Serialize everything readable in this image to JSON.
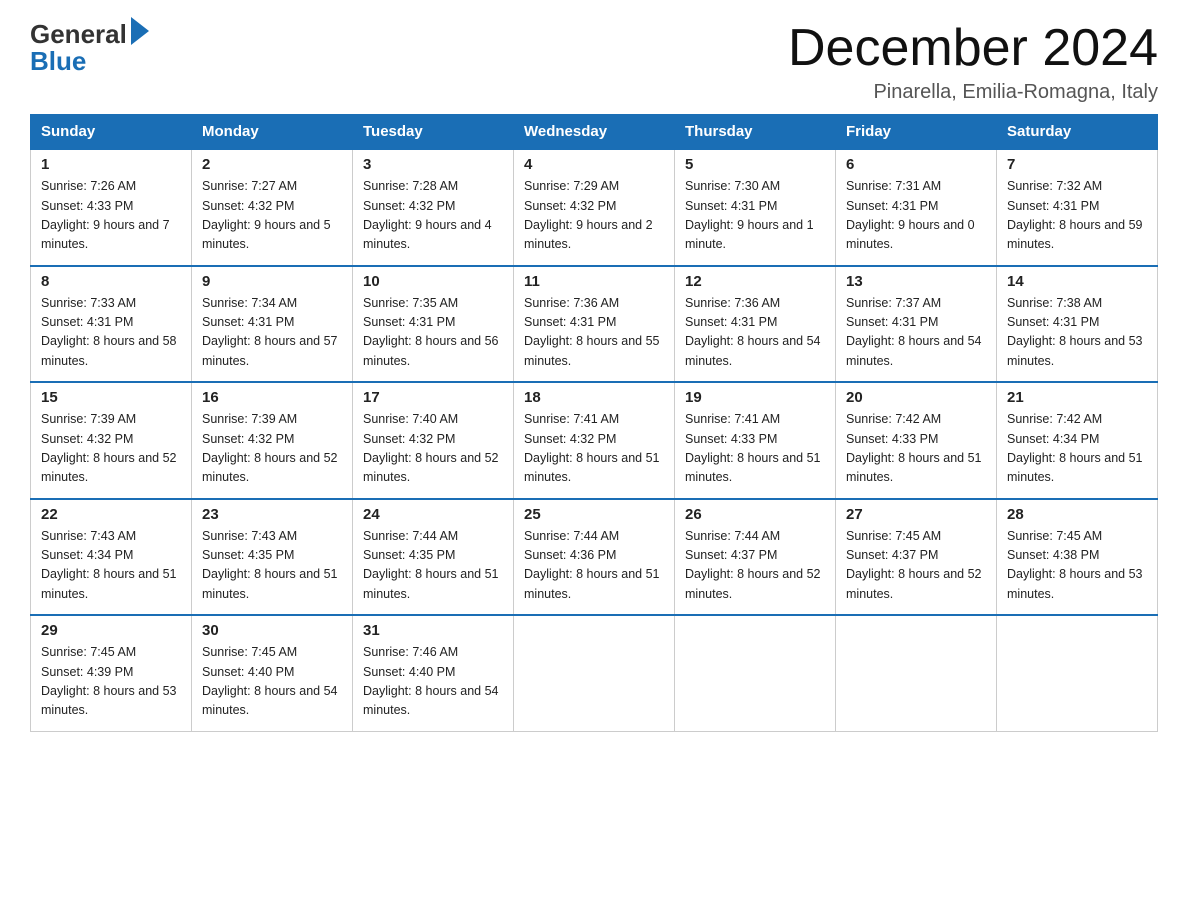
{
  "logo": {
    "general": "General",
    "blue": "Blue"
  },
  "title": "December 2024",
  "subtitle": "Pinarella, Emilia-Romagna, Italy",
  "days_of_week": [
    "Sunday",
    "Monday",
    "Tuesday",
    "Wednesday",
    "Thursday",
    "Friday",
    "Saturday"
  ],
  "weeks": [
    [
      {
        "day": "1",
        "sunrise": "7:26 AM",
        "sunset": "4:33 PM",
        "daylight": "9 hours and 7 minutes."
      },
      {
        "day": "2",
        "sunrise": "7:27 AM",
        "sunset": "4:32 PM",
        "daylight": "9 hours and 5 minutes."
      },
      {
        "day": "3",
        "sunrise": "7:28 AM",
        "sunset": "4:32 PM",
        "daylight": "9 hours and 4 minutes."
      },
      {
        "day": "4",
        "sunrise": "7:29 AM",
        "sunset": "4:32 PM",
        "daylight": "9 hours and 2 minutes."
      },
      {
        "day": "5",
        "sunrise": "7:30 AM",
        "sunset": "4:31 PM",
        "daylight": "9 hours and 1 minute."
      },
      {
        "day": "6",
        "sunrise": "7:31 AM",
        "sunset": "4:31 PM",
        "daylight": "9 hours and 0 minutes."
      },
      {
        "day": "7",
        "sunrise": "7:32 AM",
        "sunset": "4:31 PM",
        "daylight": "8 hours and 59 minutes."
      }
    ],
    [
      {
        "day": "8",
        "sunrise": "7:33 AM",
        "sunset": "4:31 PM",
        "daylight": "8 hours and 58 minutes."
      },
      {
        "day": "9",
        "sunrise": "7:34 AM",
        "sunset": "4:31 PM",
        "daylight": "8 hours and 57 minutes."
      },
      {
        "day": "10",
        "sunrise": "7:35 AM",
        "sunset": "4:31 PM",
        "daylight": "8 hours and 56 minutes."
      },
      {
        "day": "11",
        "sunrise": "7:36 AM",
        "sunset": "4:31 PM",
        "daylight": "8 hours and 55 minutes."
      },
      {
        "day": "12",
        "sunrise": "7:36 AM",
        "sunset": "4:31 PM",
        "daylight": "8 hours and 54 minutes."
      },
      {
        "day": "13",
        "sunrise": "7:37 AM",
        "sunset": "4:31 PM",
        "daylight": "8 hours and 54 minutes."
      },
      {
        "day": "14",
        "sunrise": "7:38 AM",
        "sunset": "4:31 PM",
        "daylight": "8 hours and 53 minutes."
      }
    ],
    [
      {
        "day": "15",
        "sunrise": "7:39 AM",
        "sunset": "4:32 PM",
        "daylight": "8 hours and 52 minutes."
      },
      {
        "day": "16",
        "sunrise": "7:39 AM",
        "sunset": "4:32 PM",
        "daylight": "8 hours and 52 minutes."
      },
      {
        "day": "17",
        "sunrise": "7:40 AM",
        "sunset": "4:32 PM",
        "daylight": "8 hours and 52 minutes."
      },
      {
        "day": "18",
        "sunrise": "7:41 AM",
        "sunset": "4:32 PM",
        "daylight": "8 hours and 51 minutes."
      },
      {
        "day": "19",
        "sunrise": "7:41 AM",
        "sunset": "4:33 PM",
        "daylight": "8 hours and 51 minutes."
      },
      {
        "day": "20",
        "sunrise": "7:42 AM",
        "sunset": "4:33 PM",
        "daylight": "8 hours and 51 minutes."
      },
      {
        "day": "21",
        "sunrise": "7:42 AM",
        "sunset": "4:34 PM",
        "daylight": "8 hours and 51 minutes."
      }
    ],
    [
      {
        "day": "22",
        "sunrise": "7:43 AM",
        "sunset": "4:34 PM",
        "daylight": "8 hours and 51 minutes."
      },
      {
        "day": "23",
        "sunrise": "7:43 AM",
        "sunset": "4:35 PM",
        "daylight": "8 hours and 51 minutes."
      },
      {
        "day": "24",
        "sunrise": "7:44 AM",
        "sunset": "4:35 PM",
        "daylight": "8 hours and 51 minutes."
      },
      {
        "day": "25",
        "sunrise": "7:44 AM",
        "sunset": "4:36 PM",
        "daylight": "8 hours and 51 minutes."
      },
      {
        "day": "26",
        "sunrise": "7:44 AM",
        "sunset": "4:37 PM",
        "daylight": "8 hours and 52 minutes."
      },
      {
        "day": "27",
        "sunrise": "7:45 AM",
        "sunset": "4:37 PM",
        "daylight": "8 hours and 52 minutes."
      },
      {
        "day": "28",
        "sunrise": "7:45 AM",
        "sunset": "4:38 PM",
        "daylight": "8 hours and 53 minutes."
      }
    ],
    [
      {
        "day": "29",
        "sunrise": "7:45 AM",
        "sunset": "4:39 PM",
        "daylight": "8 hours and 53 minutes."
      },
      {
        "day": "30",
        "sunrise": "7:45 AM",
        "sunset": "4:40 PM",
        "daylight": "8 hours and 54 minutes."
      },
      {
        "day": "31",
        "sunrise": "7:46 AM",
        "sunset": "4:40 PM",
        "daylight": "8 hours and 54 minutes."
      },
      null,
      null,
      null,
      null
    ]
  ]
}
